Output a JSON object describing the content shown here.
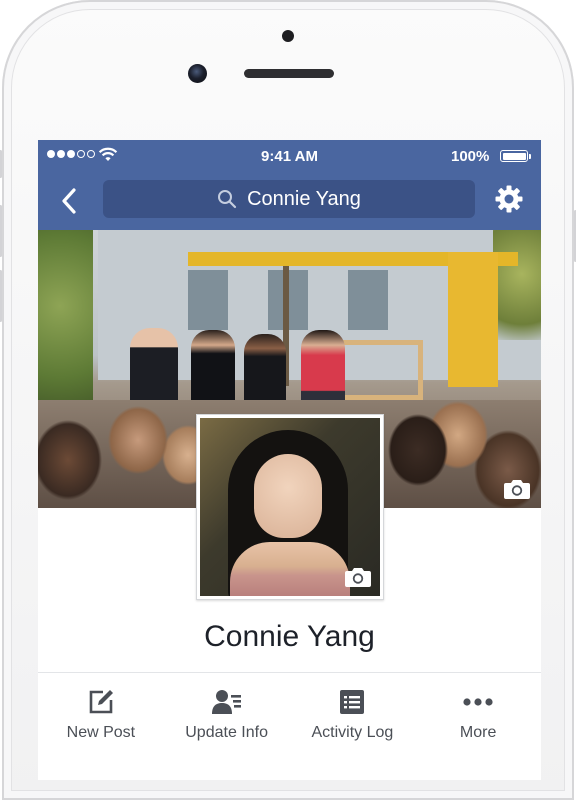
{
  "status_bar": {
    "signal_dots": 5,
    "signal_filled": 3,
    "time": "9:41 AM",
    "battery_percent": "100%",
    "battery_level": 1.0
  },
  "nav": {
    "back_icon": "chevron-left-icon",
    "search_icon": "search-icon",
    "search_text": "Connie Yang",
    "settings_icon": "gear-icon"
  },
  "cover": {
    "camera_icon": "camera-icon"
  },
  "profile": {
    "name": "Connie Yang",
    "camera_icon": "camera-icon"
  },
  "actions": [
    {
      "label": "New Post",
      "icon": "compose-icon"
    },
    {
      "label": "Update Info",
      "icon": "person-info-icon"
    },
    {
      "label": "Activity Log",
      "icon": "list-icon"
    },
    {
      "label": "More",
      "icon": "more-dots-icon"
    }
  ],
  "colors": {
    "navbar": "#4a66a0",
    "search_field": "#3b5286",
    "text_dark": "#1d2129",
    "icon_gray": "#4b4f56"
  }
}
